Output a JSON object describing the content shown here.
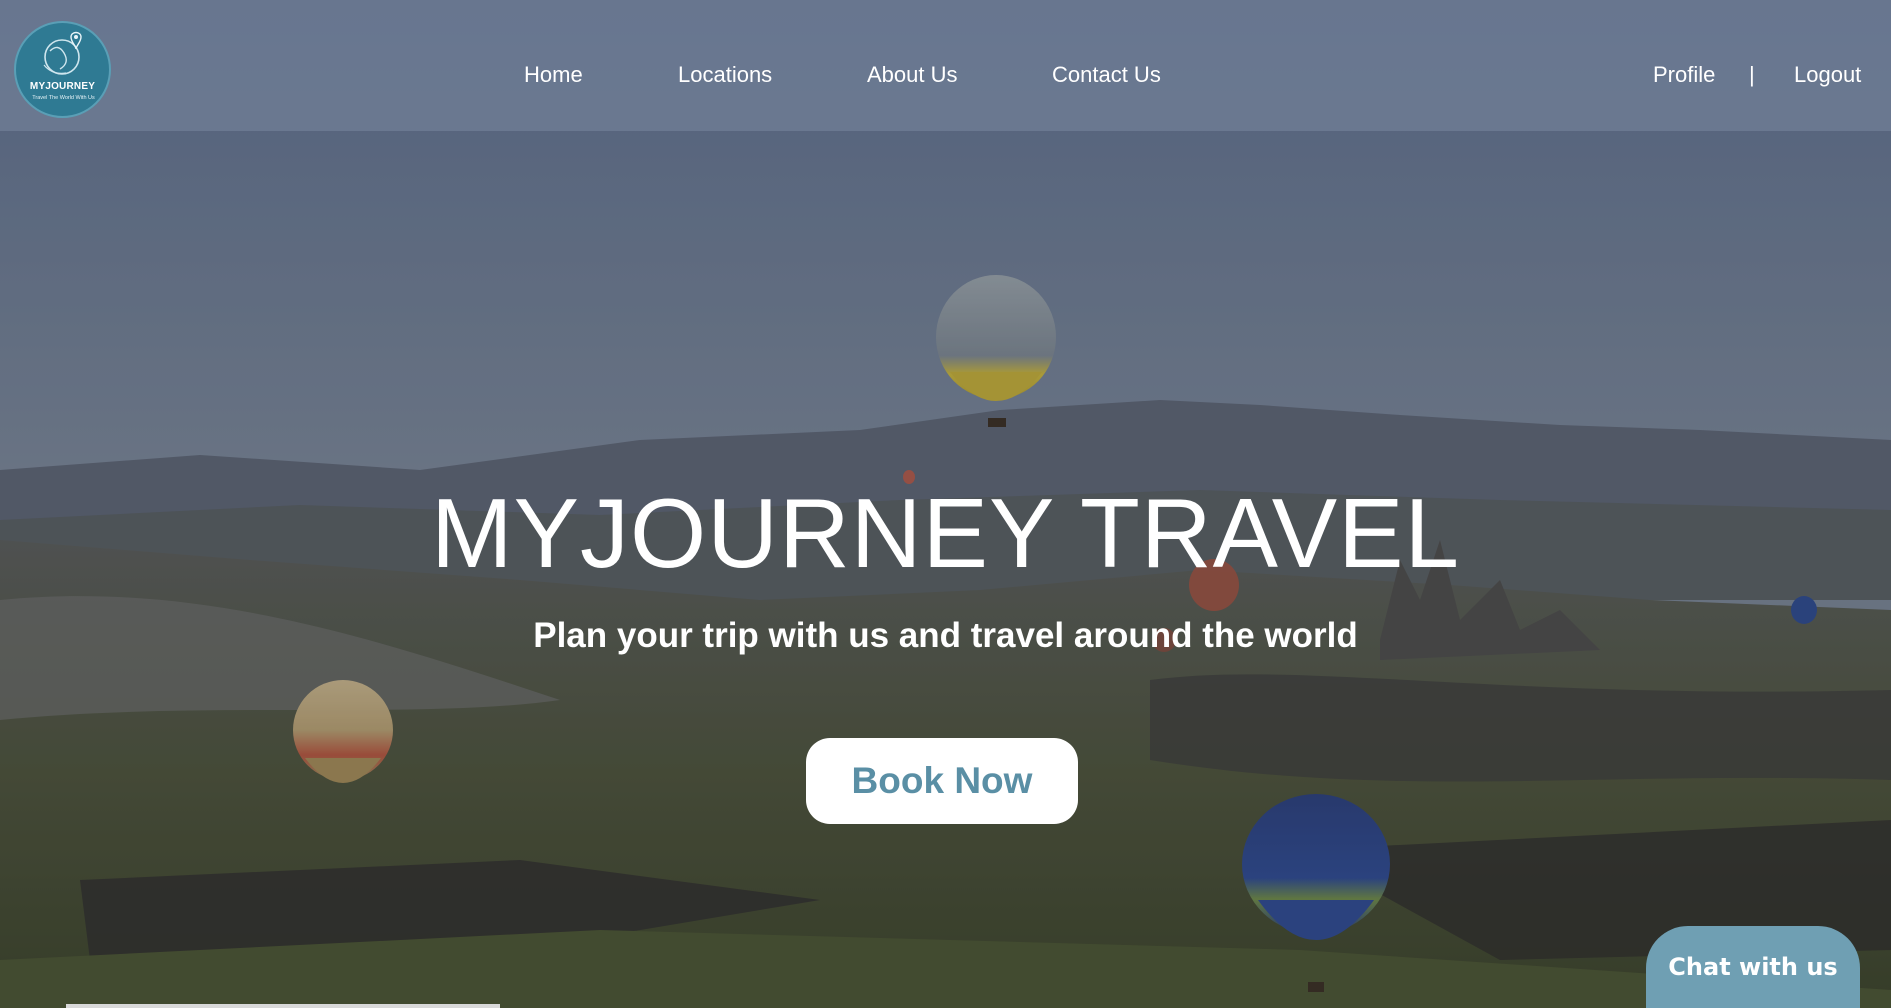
{
  "brand": {
    "name": "MYJOURNEY",
    "tagline": "Travel The World With Us"
  },
  "nav": {
    "home": "Home",
    "locations": "Locations",
    "about": "About Us",
    "contact": "Contact Us",
    "profile": "Profile",
    "separator": "|",
    "logout": "Logout"
  },
  "hero": {
    "title": "MYJOURNEY TRAVEL",
    "subtitle": "Plan your trip with us and travel around the world",
    "cta_label": "Book Now"
  },
  "chat": {
    "label": "Chat with us"
  },
  "colors": {
    "accent": "#6f9fb3",
    "logo_bg": "#2f7a93",
    "cta_text": "#5a8fa5"
  },
  "icons": {
    "logo": "globe-pin-icon",
    "hero_image": "hot-air-balloons-landscape"
  }
}
